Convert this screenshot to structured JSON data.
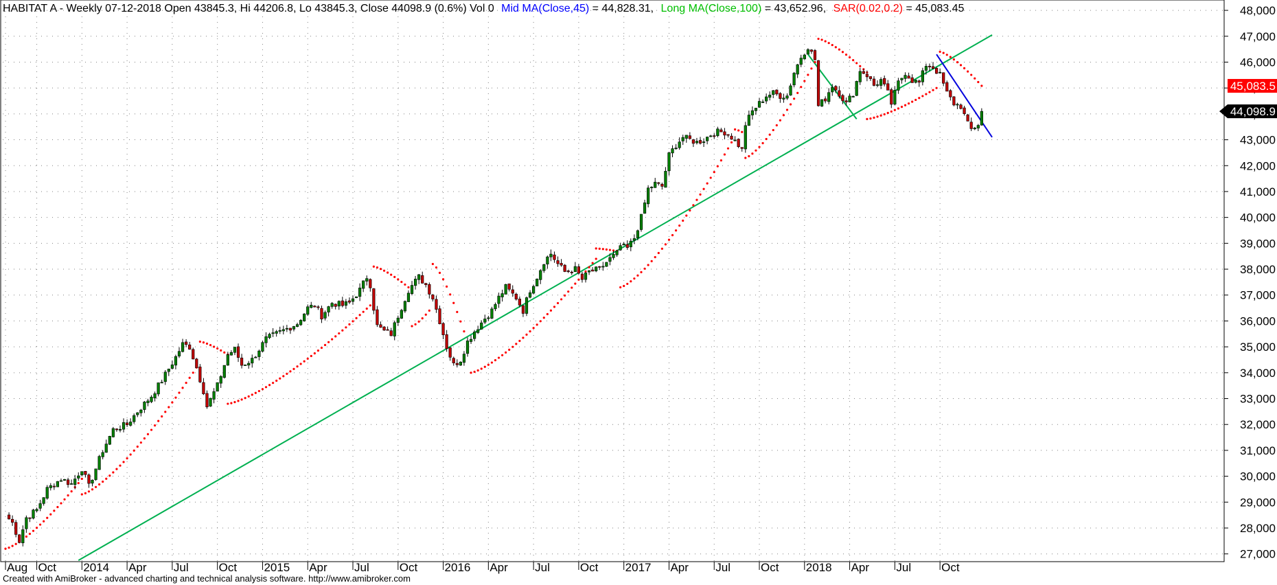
{
  "header": {
    "title": "HABITAT A - Weekly 07-12-2018 Open 43845.3, Hi 44206.8, Lo 43845.3, Close 44098.9 (0.6%) Vol 0",
    "mid_ma_label": "Mid MA(Close,45)",
    "mid_ma_value": " = 44,828.31,",
    "long_ma_label": "Long MA(Close,100)",
    "long_ma_value": " = 43,652.96,",
    "sar_label": "SAR(0.02,0.2)",
    "sar_value": " = 45,083.45"
  },
  "footer": {
    "text": "Created with AmiBroker - advanced charting and technical analysis software. http://www.amibroker.com"
  },
  "colors": {
    "up": "#008000",
    "down": "#c00000",
    "sar": "#ff0000",
    "trendline": "#00b050",
    "downtrend": "#0000dd",
    "grid": "#808080",
    "mid_ma_text": "#0000ff",
    "long_ma_text": "#00c000",
    "sar_text": "#ff0000"
  },
  "chart_data": {
    "type": "candlestick",
    "symbol": "HABITAT A",
    "interval": "Weekly",
    "ylim": [
      26700,
      48400
    ],
    "y_ticks": [
      27000,
      28000,
      29000,
      30000,
      31000,
      32000,
      33000,
      34000,
      35000,
      36000,
      37000,
      38000,
      39000,
      40000,
      41000,
      42000,
      43000,
      44000,
      45000,
      46000,
      47000,
      48000
    ],
    "y_tick_labels": [
      "27,000",
      "28,000",
      "29,000",
      "30,000",
      "31,000",
      "32,000",
      "33,000",
      "34,000",
      "35,000",
      "36,000",
      "37,000",
      "38,000",
      "39,000",
      "40,000",
      "41,000",
      "42,000",
      "43,000",
      "44,000",
      "45,000",
      "46,000",
      "47,000",
      "48,000"
    ],
    "x_labels": [
      "Aug",
      "Oct",
      "2014",
      "Apr",
      "Jul",
      "Oct",
      "2015",
      "Apr",
      "Jul",
      "Oct",
      "2016",
      "Apr",
      "Jul",
      "Oct",
      "2017",
      "Apr",
      "Jul",
      "Oct",
      "2018",
      "Apr",
      "Jul",
      "Oct"
    ],
    "x_label_weeks": [
      0,
      9,
      22,
      35,
      48,
      61,
      74,
      87,
      100,
      113,
      126,
      139,
      152,
      165,
      178,
      191,
      204,
      217,
      230,
      243,
      256,
      269
    ],
    "close_anchors": [
      [
        0,
        28500
      ],
      [
        2,
        28200
      ],
      [
        4,
        27500
      ],
      [
        6,
        28400
      ],
      [
        9,
        28700
      ],
      [
        12,
        29500
      ],
      [
        16,
        29900
      ],
      [
        19,
        29700
      ],
      [
        22,
        30300
      ],
      [
        24,
        29600
      ],
      [
        28,
        31000
      ],
      [
        31,
        31800
      ],
      [
        35,
        32000
      ],
      [
        38,
        32500
      ],
      [
        42,
        33100
      ],
      [
        45,
        33700
      ],
      [
        49,
        34600
      ],
      [
        51,
        35100
      ],
      [
        53,
        35000
      ],
      [
        55,
        34200
      ],
      [
        57,
        33300
      ],
      [
        58,
        32700
      ],
      [
        61,
        33500
      ],
      [
        64,
        34700
      ],
      [
        66,
        34900
      ],
      [
        68,
        34300
      ],
      [
        71,
        34500
      ],
      [
        73,
        34900
      ],
      [
        75,
        35300
      ],
      [
        78,
        35500
      ],
      [
        81,
        35700
      ],
      [
        84,
        35900
      ],
      [
        87,
        36500
      ],
      [
        89,
        36600
      ],
      [
        91,
        36200
      ],
      [
        94,
        36700
      ],
      [
        97,
        36600
      ],
      [
        99,
        36700
      ],
      [
        102,
        37200
      ],
      [
        104,
        37700
      ],
      [
        105,
        37400
      ],
      [
        106,
        36500
      ],
      [
        107,
        35800
      ],
      [
        109,
        35600
      ],
      [
        111,
        35500
      ],
      [
        113,
        36200
      ],
      [
        116,
        37200
      ],
      [
        119,
        37700
      ],
      [
        121,
        37400
      ],
      [
        123,
        36900
      ],
      [
        125,
        36000
      ],
      [
        127,
        35000
      ],
      [
        129,
        34300
      ],
      [
        131,
        34500
      ],
      [
        133,
        35200
      ],
      [
        135,
        35600
      ],
      [
        138,
        36100
      ],
      [
        140,
        36400
      ],
      [
        142,
        36900
      ],
      [
        144,
        37300
      ],
      [
        147,
        36900
      ],
      [
        149,
        36400
      ],
      [
        151,
        37200
      ],
      [
        153,
        37700
      ],
      [
        155,
        38300
      ],
      [
        157,
        38600
      ],
      [
        159,
        38200
      ],
      [
        161,
        37900
      ],
      [
        164,
        38000
      ],
      [
        166,
        37600
      ],
      [
        168,
        37900
      ],
      [
        171,
        38000
      ],
      [
        174,
        38400
      ],
      [
        176,
        38600
      ],
      [
        177,
        38900
      ],
      [
        179,
        38800
      ],
      [
        181,
        39200
      ],
      [
        183,
        40000
      ],
      [
        185,
        41100
      ],
      [
        187,
        41300
      ],
      [
        189,
        41200
      ],
      [
        191,
        42400
      ],
      [
        193,
        42800
      ],
      [
        195,
        43100
      ],
      [
        197,
        43000
      ],
      [
        199,
        42900
      ],
      [
        201,
        43000
      ],
      [
        203,
        43200
      ],
      [
        205,
        43300
      ],
      [
        207,
        43300
      ],
      [
        209,
        43100
      ],
      [
        211,
        42800
      ],
      [
        212,
        42600
      ],
      [
        213,
        43600
      ],
      [
        215,
        44100
      ],
      [
        217,
        44400
      ],
      [
        219,
        44700
      ],
      [
        221,
        44800
      ],
      [
        223,
        44700
      ],
      [
        225,
        44700
      ],
      [
        227,
        45600
      ],
      [
        229,
        46200
      ],
      [
        231,
        46600
      ],
      [
        233,
        46100
      ],
      [
        234,
        44300
      ],
      [
        236,
        44600
      ],
      [
        238,
        45100
      ],
      [
        240,
        44800
      ],
      [
        242,
        44400
      ],
      [
        244,
        44800
      ],
      [
        246,
        45700
      ],
      [
        248,
        45500
      ],
      [
        250,
        45100
      ],
      [
        252,
        45300
      ],
      [
        254,
        44800
      ],
      [
        255,
        44400
      ],
      [
        257,
        45200
      ],
      [
        259,
        45600
      ],
      [
        261,
        45300
      ],
      [
        263,
        45200
      ],
      [
        265,
        45900
      ],
      [
        267,
        45800
      ],
      [
        269,
        45500
      ],
      [
        271,
        44800
      ],
      [
        273,
        44400
      ],
      [
        275,
        44300
      ],
      [
        277,
        43600
      ],
      [
        278,
        43400
      ],
      [
        280,
        43600
      ],
      [
        281,
        44099
      ]
    ],
    "sar_segments": [
      {
        "from": 0,
        "to": 22,
        "side": "below",
        "start": 27200,
        "end": 29900
      },
      {
        "from": 22,
        "to": 55,
        "side": "below",
        "start": 29300,
        "end": 34200
      },
      {
        "from": 56,
        "to": 64,
        "side": "above",
        "start": 35200,
        "end": 34700
      },
      {
        "from": 64,
        "to": 105,
        "side": "below",
        "start": 32800,
        "end": 36600
      },
      {
        "from": 106,
        "to": 116,
        "side": "above",
        "start": 38100,
        "end": 37300
      },
      {
        "from": 117,
        "to": 122,
        "side": "below",
        "start": 35800,
        "end": 36400
      },
      {
        "from": 123,
        "to": 133,
        "side": "above",
        "start": 38200,
        "end": 35200
      },
      {
        "from": 134,
        "to": 170,
        "side": "below",
        "start": 34000,
        "end": 38400
      },
      {
        "from": 170,
        "to": 176,
        "side": "above",
        "start": 38800,
        "end": 38700
      },
      {
        "from": 177,
        "to": 209,
        "side": "below",
        "start": 37300,
        "end": 42900
      },
      {
        "from": 210,
        "to": 212,
        "side": "above",
        "start": 43400,
        "end": 43300
      },
      {
        "from": 213,
        "to": 233,
        "side": "below",
        "start": 42300,
        "end": 46000
      },
      {
        "from": 234,
        "to": 248,
        "side": "above",
        "start": 46900,
        "end": 45600
      },
      {
        "from": 248,
        "to": 268,
        "side": "below",
        "start": 43800,
        "end": 45000
      },
      {
        "from": 269,
        "to": 281,
        "side": "above",
        "start": 46400,
        "end": 45083
      }
    ],
    "trendlines": [
      {
        "name": "uptrend",
        "from": [
          21,
          26750
        ],
        "to": [
          284,
          47050
        ]
      },
      {
        "name": "downtrend",
        "from": [
          268,
          46300
        ],
        "to": [
          284,
          43100
        ]
      },
      {
        "name": "short-segment",
        "from": [
          231,
          46300
        ],
        "to": [
          245,
          43800
        ]
      }
    ],
    "price_labels": [
      {
        "value": 45083.5,
        "text": "45,083.5",
        "color": "#ff0000"
      },
      {
        "value": 44098.9,
        "text": "44,098.9",
        "color": "#000000"
      }
    ],
    "last": {
      "open": 43845.3,
      "high": 44206.8,
      "low": 43845.3,
      "close": 44098.9,
      "change_pct": 0.6,
      "volume": 0,
      "date": "07-12-2018"
    },
    "indicators": [
      {
        "name": "Mid MA(Close,45)",
        "value": 44828.31
      },
      {
        "name": "Long MA(Close,100)",
        "value": 43652.96
      },
      {
        "name": "SAR(0.02,0.2)",
        "value": 45083.45
      }
    ]
  }
}
